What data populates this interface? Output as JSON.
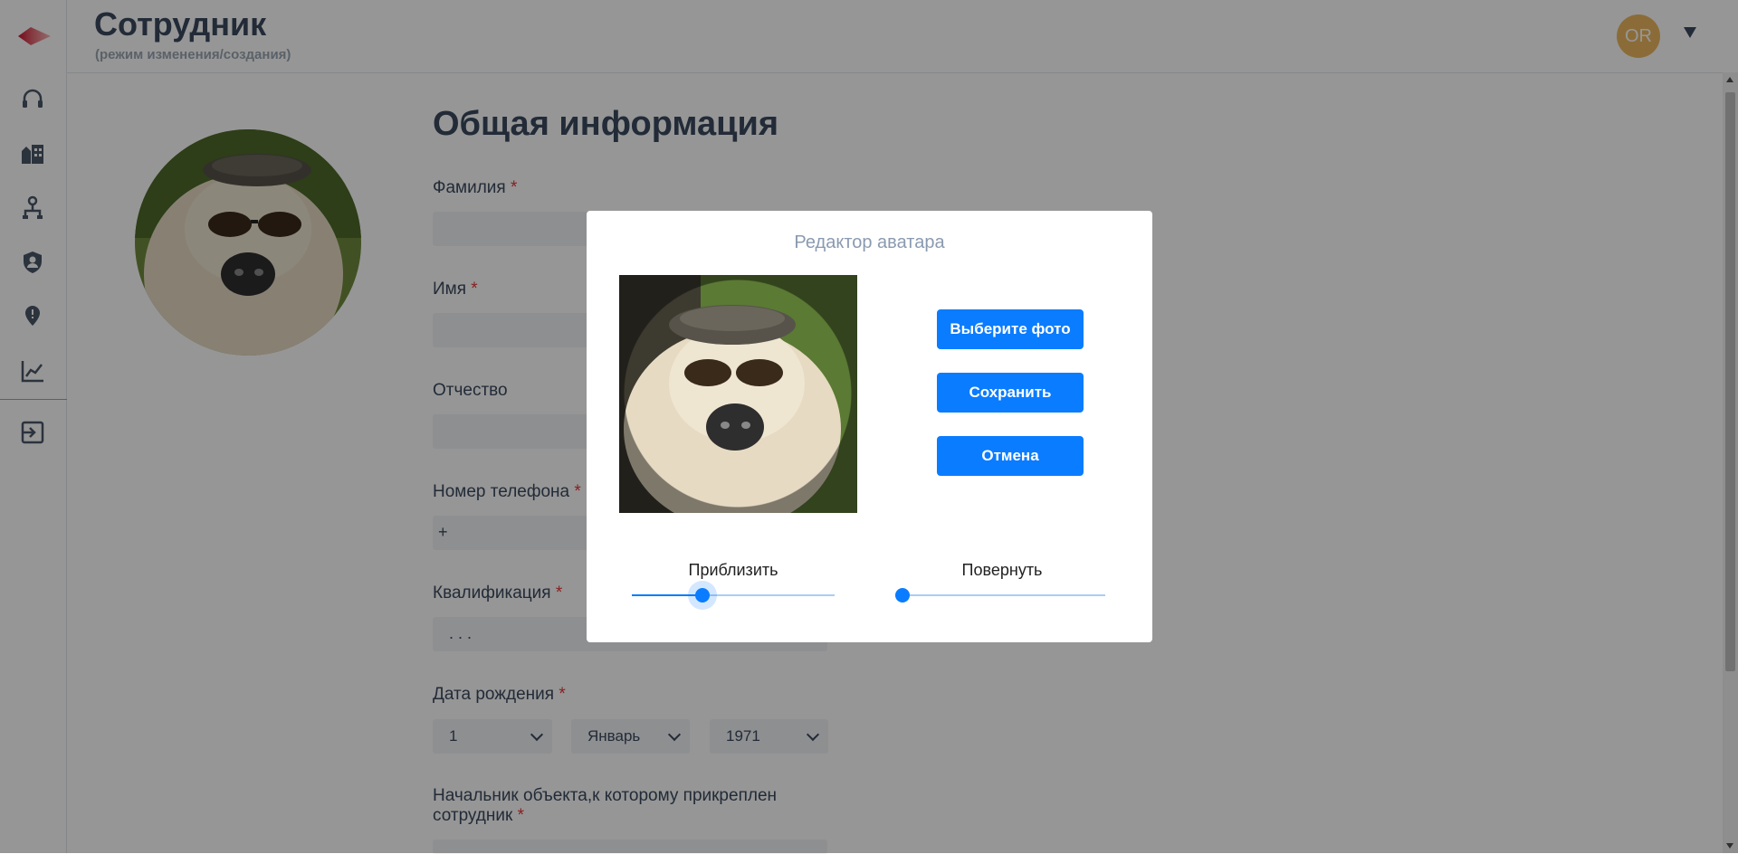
{
  "header": {
    "title": "Сотрудник",
    "subtitle": "(режим изменения/создания)",
    "user_initials": "OR"
  },
  "sidebar": {
    "items": [
      {
        "icon": "headset-icon"
      },
      {
        "icon": "buildings-icon"
      },
      {
        "icon": "hierarchy-icon"
      },
      {
        "icon": "shield-user-icon"
      },
      {
        "icon": "map-pin-icon"
      },
      {
        "icon": "line-chart-icon"
      },
      {
        "icon": "logout-icon"
      }
    ]
  },
  "form": {
    "section_title": "Общая информация",
    "last_name_label": "Фамилия",
    "first_name_label": "Имя",
    "middle_name_label": "Отчество",
    "phone_label": "Номер телефона",
    "phone_value": "+",
    "qualification_label": "Квалификация",
    "qualification_value": ". . .",
    "birth_date_label": "Дата рождения",
    "birth_day": "1",
    "birth_month": "Январь",
    "birth_year": "1971",
    "supervisor_label": "Начальник объекта,к которому прикреплен сотрудник",
    "required_mark": "*"
  },
  "modal": {
    "title": "Редактор аватара",
    "choose_photo_label": "Выберите фото",
    "save_label": "Сохранить",
    "cancel_label": "Отмена",
    "zoom_label": "Приблизить",
    "zoom_value": 0.35,
    "rotate_label": "Повернуть",
    "rotate_value": 0.0
  },
  "colors": {
    "accent": "#0a7cff",
    "avatar_bg": "#ecb860",
    "required": "#e53935"
  }
}
